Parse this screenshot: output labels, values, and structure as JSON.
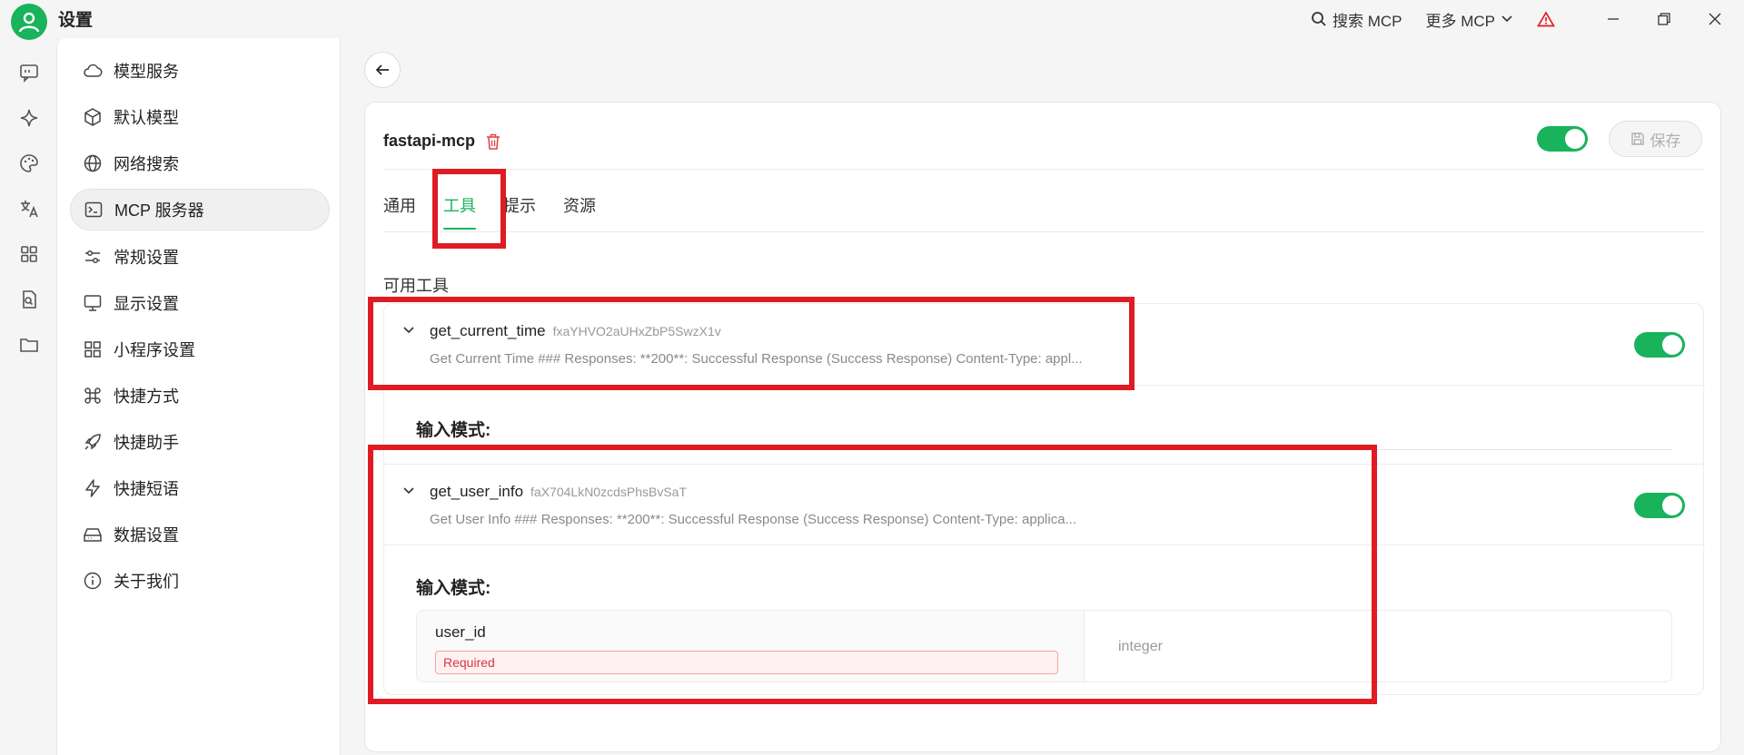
{
  "app": {
    "title": "设置"
  },
  "titlebar": {
    "search_mcp": "搜索 MCP",
    "more_mcp": "更多 MCP"
  },
  "sidebar": {
    "items": [
      {
        "label": "模型服务",
        "icon": "cloud-icon"
      },
      {
        "label": "默认模型",
        "icon": "cube-icon"
      },
      {
        "label": "网络搜索",
        "icon": "globe-icon"
      },
      {
        "label": "MCP 服务器",
        "icon": "terminal-icon",
        "active": true
      },
      {
        "label": "常规设置",
        "icon": "sliders-icon"
      },
      {
        "label": "显示设置",
        "icon": "monitor-icon"
      },
      {
        "label": "小程序设置",
        "icon": "grid-icon"
      },
      {
        "label": "快捷方式",
        "icon": "command-icon"
      },
      {
        "label": "快捷助手",
        "icon": "rocket-icon"
      },
      {
        "label": "快捷短语",
        "icon": "bolt-icon"
      },
      {
        "label": "数据设置",
        "icon": "drive-icon"
      },
      {
        "label": "关于我们",
        "icon": "info-icon"
      }
    ]
  },
  "server": {
    "name": "fastapi-mcp",
    "enabled": true,
    "save_label": "保存"
  },
  "tabs": [
    {
      "label": "通用"
    },
    {
      "label": "工具",
      "active": true
    },
    {
      "label": "提示"
    },
    {
      "label": "资源"
    }
  ],
  "tools_section": {
    "title": "可用工具",
    "tools": [
      {
        "name": "get_current_time",
        "id": "fxaYHVO2aUHxZbP5SwzX1v",
        "description": "Get Current Time ### Responses: **200**: Successful Response (Success Response) Content-Type: appl...",
        "enabled": true,
        "schema_title": "输入模式:"
      },
      {
        "name": "get_user_info",
        "id": "faX704LkN0zcdsPhsBvSaT",
        "description": "Get User Info ### Responses: **200**: Successful Response (Success Response) Content-Type: applica...",
        "enabled": true,
        "schema_title": "输入模式:",
        "params": [
          {
            "name": "user_id",
            "required_label": "Required",
            "type": "integer"
          }
        ]
      }
    ]
  },
  "colors": {
    "accent": "#19b35c",
    "highlight": "#e01b24",
    "required": "#d9363e"
  }
}
